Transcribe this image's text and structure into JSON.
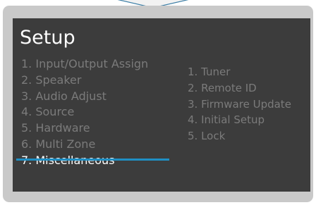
{
  "screen": {
    "title": "Setup",
    "left_menu": [
      {
        "label": "1.  Input/Output Assign",
        "selected": false
      },
      {
        "label": "2.  Speaker",
        "selected": false
      },
      {
        "label": "3.  Audio Adjust",
        "selected": false
      },
      {
        "label": "4.  Source",
        "selected": false
      },
      {
        "label": "5.  Hardware",
        "selected": false
      },
      {
        "label": "6.  Multi Zone",
        "selected": false
      },
      {
        "label": "7.  Miscellaneous",
        "selected": true
      }
    ],
    "right_menu": [
      {
        "label": "1.  Tuner"
      },
      {
        "label": "2.  Remote ID"
      },
      {
        "label": "3.  Firmware Update"
      },
      {
        "label": "4.  Initial Setup"
      },
      {
        "label": "5. Lock"
      }
    ]
  },
  "colors": {
    "frame": "#c9c9c9",
    "screen_background": "#3c3c3c",
    "title_text": "#ffffff",
    "inactive_text": "#7b7b7b",
    "selected_text": "#ffffff",
    "highlight": "#1f8fc4"
  }
}
